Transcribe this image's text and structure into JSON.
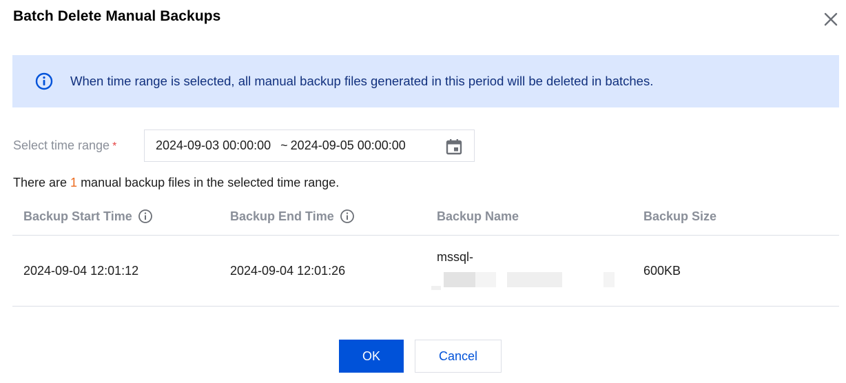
{
  "dialog": {
    "title": "Batch Delete Manual Backups"
  },
  "alert": {
    "text": "When time range is selected, all manual backup files generated in this period will be deleted in batches."
  },
  "form": {
    "label": "Select time range",
    "required_mark": "*",
    "range_start": "2024-09-03 00:00:00",
    "range_separator": "~",
    "range_end": "2024-09-05 00:00:00"
  },
  "summary": {
    "prefix": "There are ",
    "count": "1",
    "suffix": " manual backup files in the selected time range."
  },
  "table": {
    "columns": [
      "Backup Start Time",
      "Backup End Time",
      "Backup Name",
      "Backup Size"
    ],
    "rows": [
      {
        "start_time": "2024-09-04 12:01:12",
        "end_time": "2024-09-04 12:01:26",
        "name": "mssql-",
        "size": "600KB"
      }
    ]
  },
  "buttons": {
    "ok": "OK",
    "cancel": "Cancel"
  },
  "colors": {
    "primary": "#0052d9",
    "alert_bg": "#dbe7fe",
    "alert_text": "#11307d",
    "count_highlight": "#ec6b1f",
    "required": "#e54545"
  },
  "icons": {
    "close": "close-icon",
    "alert": "info-circle-icon",
    "calendar": "calendar-icon",
    "column_info": "info-circle-icon"
  }
}
